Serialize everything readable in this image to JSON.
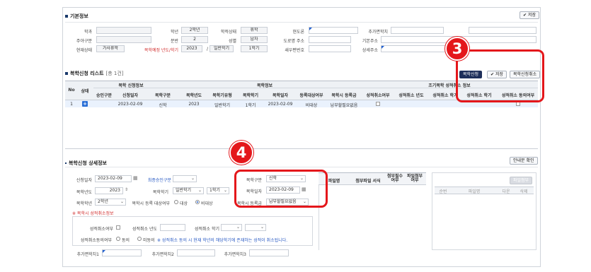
{
  "basic": {
    "title": "기본정보",
    "save": "저장",
    "row1": {
      "dept": "학과",
      "grade_label": "학년",
      "grade": "2학년",
      "status_label": "학적상태",
      "status": "휴학",
      "bankbook": "현도론",
      "extra_label": "추가면학치"
    },
    "row2": {
      "major_label": "주야구분",
      "class_label": "분반",
      "class": "2",
      "gender_label": "성별",
      "gender": "남자",
      "addr_label": "도로명 주소",
      "base_addr_label": "기본주소"
    },
    "row3": {
      "cur_label": "현재상태",
      "cur": "가사휴학",
      "year_label": "복학예정 년도/학기",
      "year": "2023",
      "sep": "/",
      "term_type": "일반학기",
      "term": "1학기",
      "zip_label": "새우편번호",
      "detail_label": "상세주소"
    }
  },
  "list": {
    "title": "복학신청 리스트",
    "count": "[총 1건]",
    "btn_apply": "복학신청",
    "btn_save": "저장",
    "btn_cancel": "복학신청취소",
    "headers": {
      "no": "No",
      "state": "상태",
      "group1": "복학 신청정보",
      "group2": "복학정보",
      "group3": "조기복학 성적취소 정보",
      "cols": [
        "승인구분",
        "신청일자",
        "복학구분",
        "복학년도",
        "복학기유형",
        "복학학기",
        "복학일자",
        "등록대상여부",
        "복학시 등록금",
        "성적취소여부",
        "성적취소 년도",
        "성적취소 학기",
        "성적취소 학기",
        "성적취소 동의여부"
      ]
    },
    "row": {
      "no": "1",
      "plus": "+",
      "date": "2023-02-09",
      "kind": "신학",
      "year": "2023",
      "type": "일반학기",
      "term": "1학기",
      "bdate": "2023-02-09",
      "target": "비대상",
      "fee": "납부할필요없음"
    }
  },
  "detail": {
    "title": "복학신청 상세정보",
    "guide_btn": "안내문 확인",
    "apply_date_label": "신청일자",
    "apply_date": "2023-02-09",
    "approve_label": "최종승인구분",
    "ret_year_label": "복학년도",
    "ret_year": "2023",
    "ret_term_label": "복학학기",
    "ret_term_type": "일반학기",
    "ret_term": "1학기",
    "ret_grade_label": "복학학년",
    "ret_grade": "2학년",
    "reg_target_label": "복학시 등록 대상여부",
    "opt_target": "대상",
    "opt_nontarget": "비대상",
    "kind_label": "복학구분",
    "kind": "신학",
    "bdate_label": "복학일자",
    "bdate": "2023-02-09",
    "fee_label": "복학시 등록금",
    "fee": "납부할필요없음",
    "cancel_info": "※ 복학시 성적취소정보",
    "cancel_yn_label": "성적취소여부",
    "cancel_year_label": "성적취소 년도",
    "cancel_term_label": "성적취소 학기",
    "agree_label": "성적취소동의여부",
    "agree": "동의",
    "disagree": "미동의",
    "agree_note": "※ 성적취소 동의 시 현재 학년의 해당학기에 존재하는 성적이 취소됩니다.",
    "extra1": "추가면학치1",
    "extra2": "추가면학치2",
    "extra3": "추가면학치3",
    "file_cols": [
      "파일명",
      "첨부파일 서식",
      "첨부필수 여부",
      "파일첨부 여부"
    ],
    "attach_btn": "파일첨부",
    "attach_cols": [
      "순번",
      "파일명",
      "다운",
      "삭제"
    ]
  },
  "callouts": {
    "three": "3",
    "four": "4"
  }
}
